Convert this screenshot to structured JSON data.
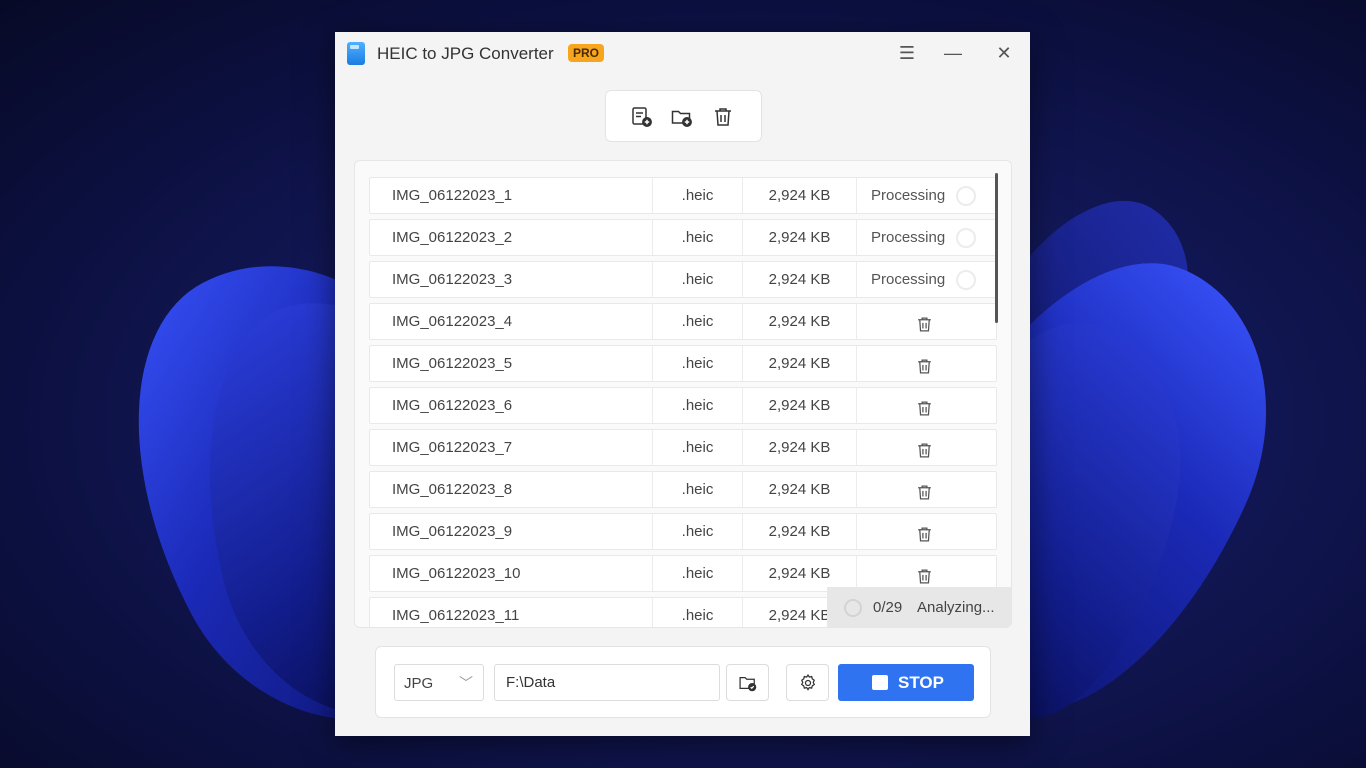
{
  "app": {
    "title": "HEIC to JPG Converter",
    "badge": "PRO"
  },
  "window_controls": {
    "menu": "☰",
    "minimize": "—",
    "close": "✕"
  },
  "files": [
    {
      "name": "IMG_06122023_1",
      "ext": ".heic",
      "size": "2,924 KB",
      "status": "Processing"
    },
    {
      "name": "IMG_06122023_2",
      "ext": ".heic",
      "size": "2,924 KB",
      "status": "Processing"
    },
    {
      "name": "IMG_06122023_3",
      "ext": ".heic",
      "size": "2,924 KB",
      "status": "Processing"
    },
    {
      "name": "IMG_06122023_4",
      "ext": ".heic",
      "size": "2,924 KB",
      "status": ""
    },
    {
      "name": "IMG_06122023_5",
      "ext": ".heic",
      "size": "2,924 KB",
      "status": ""
    },
    {
      "name": "IMG_06122023_6",
      "ext": ".heic",
      "size": "2,924 KB",
      "status": ""
    },
    {
      "name": "IMG_06122023_7",
      "ext": ".heic",
      "size": "2,924 KB",
      "status": ""
    },
    {
      "name": "IMG_06122023_8",
      "ext": ".heic",
      "size": "2,924 KB",
      "status": ""
    },
    {
      "name": "IMG_06122023_9",
      "ext": ".heic",
      "size": "2,924 KB",
      "status": ""
    },
    {
      "name": "IMG_06122023_10",
      "ext": ".heic",
      "size": "2,924 KB",
      "status": ""
    },
    {
      "name": "IMG_06122023_11",
      "ext": ".heic",
      "size": "2,924 KB",
      "status": ""
    }
  ],
  "progress": {
    "count": "0/29",
    "status": "Analyzing..."
  },
  "output": {
    "format": "JPG",
    "path": "F:\\Data"
  },
  "stop_button": {
    "label": "STOP"
  },
  "colors": {
    "accent": "#2f73f0",
    "badge": "#f7a51c"
  }
}
